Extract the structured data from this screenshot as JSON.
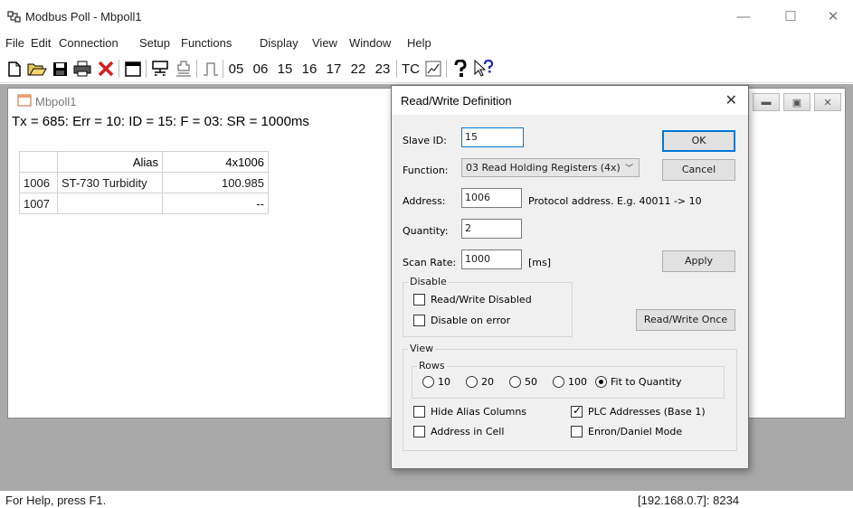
{
  "window": {
    "title": "Modbus Poll - Mbpoll1",
    "controls": {
      "minimize": "—",
      "maximize": "☐",
      "close": "✕"
    }
  },
  "menu": [
    "File",
    "Edit",
    "Connection",
    "Setup",
    "Functions",
    "Display",
    "View",
    "Window",
    "Help"
  ],
  "toolbar": {
    "function_codes": [
      "05",
      "06",
      "15",
      "16",
      "17",
      "22",
      "23"
    ],
    "tc_label": "TC"
  },
  "child": {
    "title": "Mbpoll1",
    "status": "Tx = 685: Err = 10: ID = 15: F = 03: SR = 1000ms",
    "table": {
      "headers": [
        "",
        "Alias",
        "4x1006"
      ],
      "rows": [
        {
          "addr": "1006",
          "alias": "ST-730 Turbidity",
          "value": "100.985"
        },
        {
          "addr": "1007",
          "alias": "",
          "value": "--"
        }
      ]
    }
  },
  "statusbar": {
    "left": "For Help, press F1.",
    "right": "[192.168.0.7]: 8234"
  },
  "dialog": {
    "title": "Read/Write Definition",
    "slave_id_label": "Slave ID:",
    "slave_id_value": "15",
    "function_label": "Function:",
    "function_value": "03 Read Holding Registers (4x)",
    "address_label": "Address:",
    "address_value": "1006",
    "address_hint": "Protocol address. E.g. 40011 -> 10",
    "quantity_label": "Quantity:",
    "quantity_value": "2",
    "scan_rate_label": "Scan Rate:",
    "scan_rate_value": "1000",
    "scan_rate_unit": "[ms]",
    "ok": "OK",
    "cancel": "Cancel",
    "apply": "Apply",
    "disable_group": "Disable",
    "rw_disabled": "Read/Write Disabled",
    "disable_on_error": "Disable on error",
    "rw_once": "Read/Write Once",
    "view_group": "View",
    "rows_group": "Rows",
    "rows_options": [
      "10",
      "20",
      "50",
      "100",
      "Fit to Quantity"
    ],
    "hide_alias": "Hide Alias Columns",
    "plc_addresses": "PLC Addresses (Base 1)",
    "address_in_cell": "Address in Cell",
    "enron_mode": "Enron/Daniel Mode"
  }
}
